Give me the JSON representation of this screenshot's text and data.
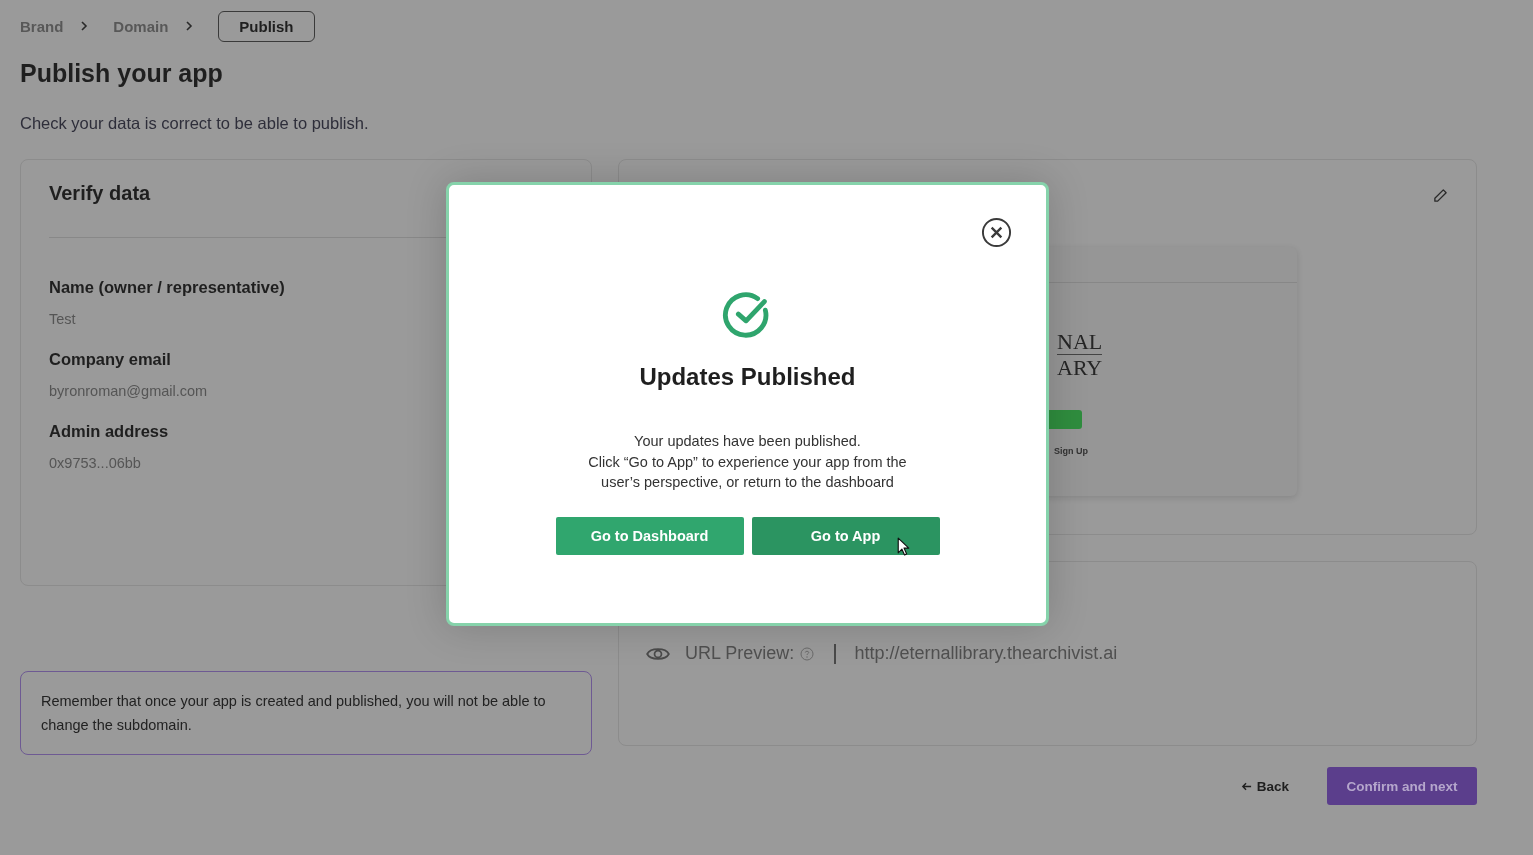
{
  "breadcrumb": [
    {
      "label": "Brand",
      "selected": false
    },
    {
      "label": "Domain",
      "selected": false
    },
    {
      "label": "Publish",
      "selected": true
    }
  ],
  "page": {
    "title": "Publish your app",
    "subtitle": "Check your data is correct to be able to publish."
  },
  "verify_card": {
    "title": "Verify data",
    "fields": [
      {
        "label": "Name (owner / representative)",
        "value": "Test"
      },
      {
        "label": "Company email",
        "value": "byronroman@gmail.com"
      },
      {
        "label": "Admin address",
        "value": "0x9753...06bb"
      }
    ]
  },
  "preview_card": {
    "logo_lines": [
      "NAL",
      "ARY"
    ],
    "link": "Sign Up"
  },
  "url_preview": {
    "label": "URL Preview:",
    "url": "http://eternallibrary.thearchivist.ai"
  },
  "notice": "Remember that once your app is created and published, you will not be able to change the subdomain.",
  "footer": {
    "back": "Back",
    "next": "Confirm and next"
  },
  "modal": {
    "title": "Updates Published",
    "message": "Your updates have been published.\nClick “Go to App” to experience your app from the\nuser’s perspective, or return to the dashboard",
    "buttons": [
      {
        "label": "Go to Dashboard",
        "hovered": false
      },
      {
        "label": "Go to App",
        "hovered": true
      }
    ]
  }
}
